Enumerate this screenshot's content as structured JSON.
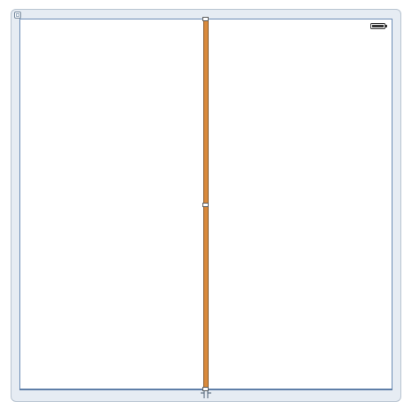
{
  "window": {
    "accent_color": "#d98a3c",
    "frame_color": "#e6ecf3",
    "canvas_color": "#ffffff",
    "canvas_border_color": "#6b8bb5"
  },
  "icons": {
    "corner": "window-corner-icon",
    "status": "battery-icon",
    "dock": "split-dock-icon"
  }
}
